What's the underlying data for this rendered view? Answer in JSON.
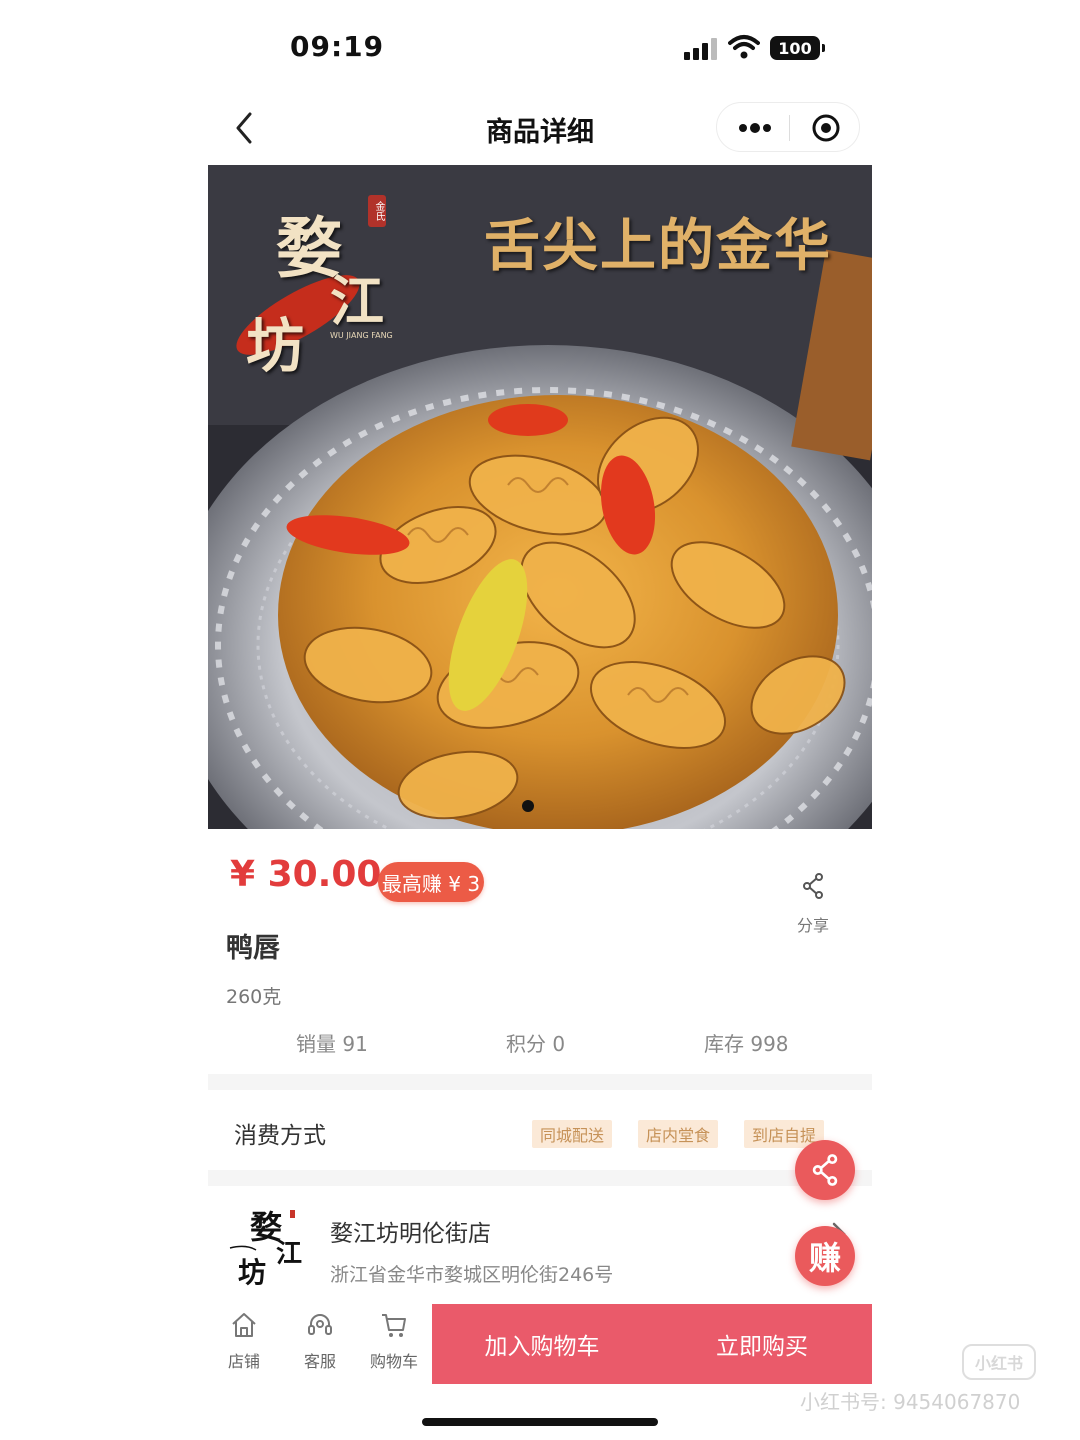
{
  "status_bar": {
    "time": "09:19",
    "battery": "100"
  },
  "nav": {
    "title": "商品详细"
  },
  "hero": {
    "headline": "舌尖上的金华",
    "logo": {
      "chars": [
        "婺",
        "江",
        "坊"
      ],
      "seal": "金氏",
      "subtitle": "WU JIANG FANG"
    }
  },
  "product": {
    "price": "¥ 30.00",
    "earn_badge": "最高赚 ¥ 3",
    "share_label": "分享",
    "name": "鸭唇",
    "spec": "260克",
    "stats": {
      "sales": "销量 91",
      "points": "积分 0",
      "stock": "库存 998"
    }
  },
  "consumption": {
    "title": "消费方式",
    "options": [
      "同城配送",
      "店内堂食",
      "到店自提"
    ]
  },
  "store": {
    "name": "婺江坊明伦街店",
    "address": "浙江省金华市婺城区明伦街246号"
  },
  "fab": {
    "earn_label": "赚"
  },
  "bottom_bar": {
    "tabs": [
      {
        "label": "店铺",
        "icon": "home-icon"
      },
      {
        "label": "客服",
        "icon": "headset-icon"
      },
      {
        "label": "购物车",
        "icon": "cart-icon"
      }
    ],
    "add_to_cart": "加入购物车",
    "buy_now": "立即购买"
  },
  "watermark": {
    "logo": "小红书",
    "text": "小红书号: 9454067870"
  },
  "colors": {
    "accent": "#ea5a6a",
    "price": "#e23c3c",
    "tag_bg": "#fbe9d7",
    "tag_text": "#c69258"
  }
}
